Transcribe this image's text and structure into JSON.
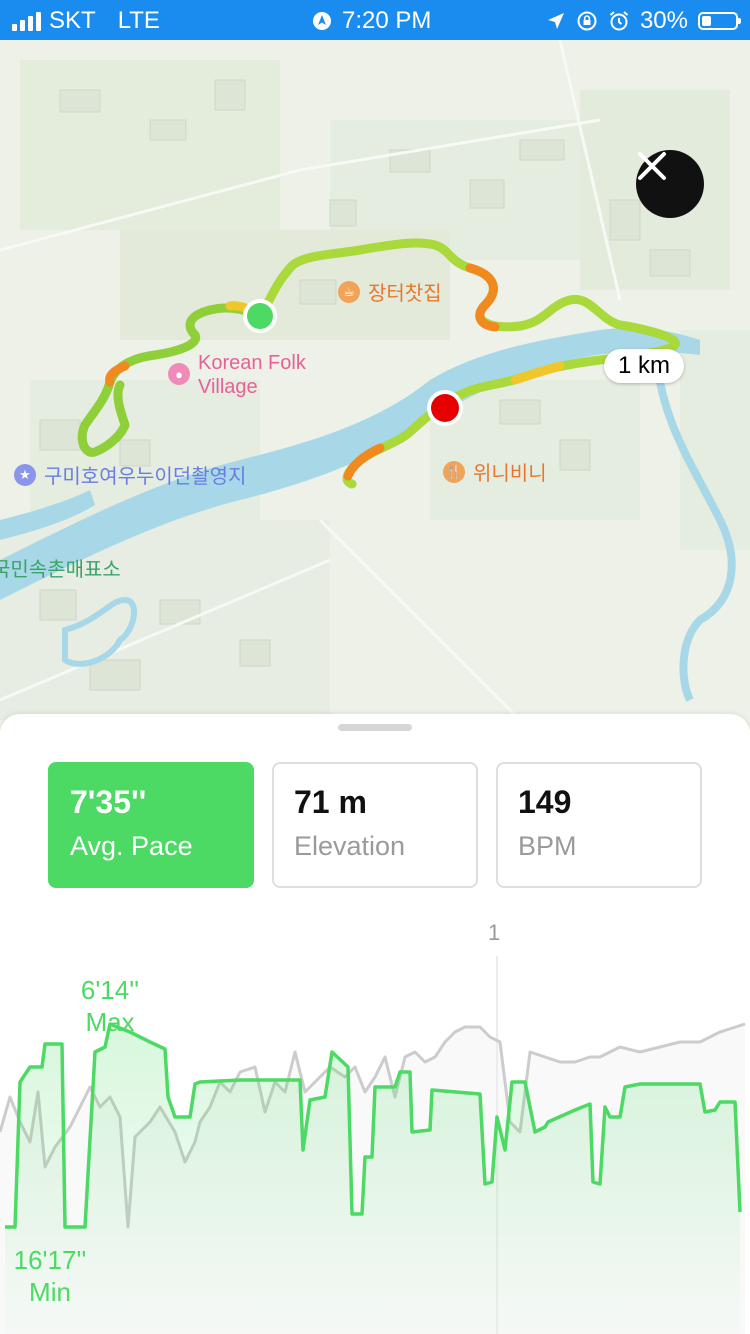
{
  "status_bar": {
    "carrier": "SKT",
    "network": "LTE",
    "time": "7:20 PM",
    "battery": "30%"
  },
  "map": {
    "places": {
      "cafe": "장터찻집",
      "folk_village_line1": "Korean Folk",
      "folk_village_line2": "Village",
      "filming_site": "구미호여우누이던촬영지",
      "restaurant": "위니비니",
      "ticket_office": "국민속촌매표소"
    },
    "distance_badge": "1 km",
    "start_marker_color": "#4cd964",
    "end_marker_color": "#e60000"
  },
  "stats": {
    "pace": {
      "value": "7'35''",
      "label": "Avg. Pace"
    },
    "elevation": {
      "value": "71 m",
      "label": "Elevation"
    },
    "heart_rate": {
      "value": "149",
      "label": "BPM"
    }
  },
  "chart": {
    "km_marker": "1",
    "max_value": "6'14''",
    "max_label": "Max",
    "min_value": "16'17''",
    "min_label": "Min",
    "pace_color": "#4cd964",
    "elevation_color": "#cccccc"
  },
  "colors": {
    "accent": "#4cd964",
    "status_bar": "#1a8cf0"
  }
}
